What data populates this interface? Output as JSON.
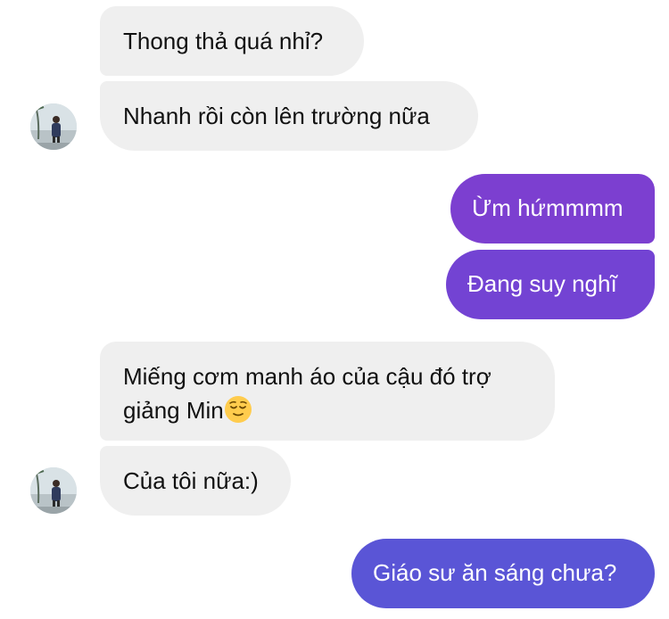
{
  "conversation": {
    "messages": [
      {
        "sender": "them",
        "text": "Thong thả quá nhỉ?"
      },
      {
        "sender": "them",
        "text": "Nhanh rồi còn lên trường nữa"
      },
      {
        "sender": "me",
        "text": "Ừm hứmmmm"
      },
      {
        "sender": "me",
        "text": "Đang suy nghĩ"
      },
      {
        "sender": "them",
        "text_line1": "Miếng cơm manh áo của cậu đó trợ",
        "text_line2": "giảng Min",
        "emoji": "relieved-face-emoji"
      },
      {
        "sender": "them",
        "text": "Của tôi nữa:)"
      },
      {
        "sender": "me",
        "text": "Giáo sư ăn sáng chưa?"
      }
    ]
  },
  "colors": {
    "incoming_bubble": "#efefef",
    "outgoing_top": "#7c3fd0",
    "outgoing_mid": "#7343d3",
    "outgoing_bottom": "#5a55d6"
  },
  "icons": [
    "avatar-photo",
    "relieved-face-emoji"
  ]
}
